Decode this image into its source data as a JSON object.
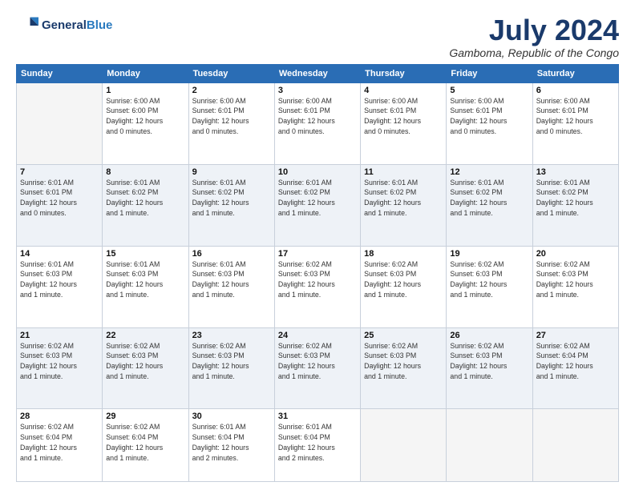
{
  "logo": {
    "line1": "General",
    "line2": "Blue"
  },
  "title": "July 2024",
  "location": "Gamboma, Republic of the Congo",
  "weekdays": [
    "Sunday",
    "Monday",
    "Tuesday",
    "Wednesday",
    "Thursday",
    "Friday",
    "Saturday"
  ],
  "weeks": [
    [
      {
        "num": "",
        "info": ""
      },
      {
        "num": "1",
        "info": "Sunrise: 6:00 AM\nSunset: 6:00 PM\nDaylight: 12 hours\nand 0 minutes."
      },
      {
        "num": "2",
        "info": "Sunrise: 6:00 AM\nSunset: 6:01 PM\nDaylight: 12 hours\nand 0 minutes."
      },
      {
        "num": "3",
        "info": "Sunrise: 6:00 AM\nSunset: 6:01 PM\nDaylight: 12 hours\nand 0 minutes."
      },
      {
        "num": "4",
        "info": "Sunrise: 6:00 AM\nSunset: 6:01 PM\nDaylight: 12 hours\nand 0 minutes."
      },
      {
        "num": "5",
        "info": "Sunrise: 6:00 AM\nSunset: 6:01 PM\nDaylight: 12 hours\nand 0 minutes."
      },
      {
        "num": "6",
        "info": "Sunrise: 6:00 AM\nSunset: 6:01 PM\nDaylight: 12 hours\nand 0 minutes."
      }
    ],
    [
      {
        "num": "7",
        "info": "Sunrise: 6:01 AM\nSunset: 6:01 PM\nDaylight: 12 hours\nand 0 minutes."
      },
      {
        "num": "8",
        "info": "Sunrise: 6:01 AM\nSunset: 6:02 PM\nDaylight: 12 hours\nand 1 minute."
      },
      {
        "num": "9",
        "info": "Sunrise: 6:01 AM\nSunset: 6:02 PM\nDaylight: 12 hours\nand 1 minute."
      },
      {
        "num": "10",
        "info": "Sunrise: 6:01 AM\nSunset: 6:02 PM\nDaylight: 12 hours\nand 1 minute."
      },
      {
        "num": "11",
        "info": "Sunrise: 6:01 AM\nSunset: 6:02 PM\nDaylight: 12 hours\nand 1 minute."
      },
      {
        "num": "12",
        "info": "Sunrise: 6:01 AM\nSunset: 6:02 PM\nDaylight: 12 hours\nand 1 minute."
      },
      {
        "num": "13",
        "info": "Sunrise: 6:01 AM\nSunset: 6:02 PM\nDaylight: 12 hours\nand 1 minute."
      }
    ],
    [
      {
        "num": "14",
        "info": "Sunrise: 6:01 AM\nSunset: 6:03 PM\nDaylight: 12 hours\nand 1 minute."
      },
      {
        "num": "15",
        "info": "Sunrise: 6:01 AM\nSunset: 6:03 PM\nDaylight: 12 hours\nand 1 minute."
      },
      {
        "num": "16",
        "info": "Sunrise: 6:01 AM\nSunset: 6:03 PM\nDaylight: 12 hours\nand 1 minute."
      },
      {
        "num": "17",
        "info": "Sunrise: 6:02 AM\nSunset: 6:03 PM\nDaylight: 12 hours\nand 1 minute."
      },
      {
        "num": "18",
        "info": "Sunrise: 6:02 AM\nSunset: 6:03 PM\nDaylight: 12 hours\nand 1 minute."
      },
      {
        "num": "19",
        "info": "Sunrise: 6:02 AM\nSunset: 6:03 PM\nDaylight: 12 hours\nand 1 minute."
      },
      {
        "num": "20",
        "info": "Sunrise: 6:02 AM\nSunset: 6:03 PM\nDaylight: 12 hours\nand 1 minute."
      }
    ],
    [
      {
        "num": "21",
        "info": "Sunrise: 6:02 AM\nSunset: 6:03 PM\nDaylight: 12 hours\nand 1 minute."
      },
      {
        "num": "22",
        "info": "Sunrise: 6:02 AM\nSunset: 6:03 PM\nDaylight: 12 hours\nand 1 minute."
      },
      {
        "num": "23",
        "info": "Sunrise: 6:02 AM\nSunset: 6:03 PM\nDaylight: 12 hours\nand 1 minute."
      },
      {
        "num": "24",
        "info": "Sunrise: 6:02 AM\nSunset: 6:03 PM\nDaylight: 12 hours\nand 1 minute."
      },
      {
        "num": "25",
        "info": "Sunrise: 6:02 AM\nSunset: 6:03 PM\nDaylight: 12 hours\nand 1 minute."
      },
      {
        "num": "26",
        "info": "Sunrise: 6:02 AM\nSunset: 6:03 PM\nDaylight: 12 hours\nand 1 minute."
      },
      {
        "num": "27",
        "info": "Sunrise: 6:02 AM\nSunset: 6:04 PM\nDaylight: 12 hours\nand 1 minute."
      }
    ],
    [
      {
        "num": "28",
        "info": "Sunrise: 6:02 AM\nSunset: 6:04 PM\nDaylight: 12 hours\nand 1 minute."
      },
      {
        "num": "29",
        "info": "Sunrise: 6:02 AM\nSunset: 6:04 PM\nDaylight: 12 hours\nand 1 minute."
      },
      {
        "num": "30",
        "info": "Sunrise: 6:01 AM\nSunset: 6:04 PM\nDaylight: 12 hours\nand 2 minutes."
      },
      {
        "num": "31",
        "info": "Sunrise: 6:01 AM\nSunset: 6:04 PM\nDaylight: 12 hours\nand 2 minutes."
      },
      {
        "num": "",
        "info": ""
      },
      {
        "num": "",
        "info": ""
      },
      {
        "num": "",
        "info": ""
      }
    ]
  ]
}
